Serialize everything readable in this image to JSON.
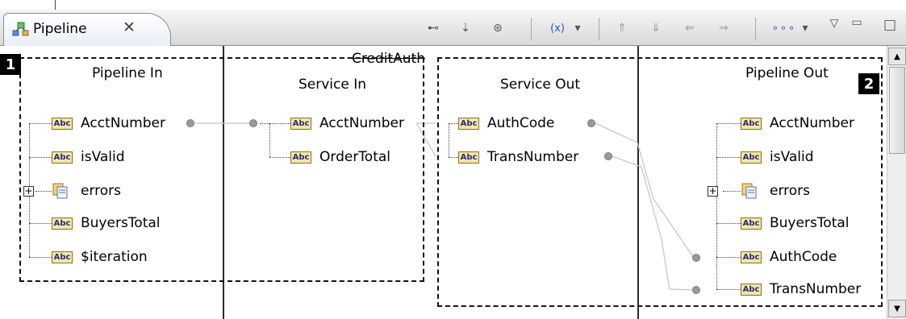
{
  "tab": {
    "title": "Pipeline",
    "close_glyph": "✕"
  },
  "toolbar": {
    "buttons": [
      {
        "icon": "link-icon",
        "glyph": "⊷"
      },
      {
        "icon": "map-value-icon",
        "glyph": "⇣"
      },
      {
        "icon": "drop-icon",
        "glyph": "⊛"
      },
      {
        "icon": "transformer-icon",
        "glyph": "(x)"
      },
      {
        "icon": "dropdown-arrow-icon",
        "glyph": "▾"
      },
      {
        "icon": "shift-up-icon",
        "glyph": "⇑"
      },
      {
        "icon": "shift-down-icon",
        "glyph": "⇓"
      },
      {
        "icon": "shift-left-icon",
        "glyph": "⇐"
      },
      {
        "icon": "shift-right-icon",
        "glyph": "⇒"
      },
      {
        "icon": "layout-icon",
        "glyph": "⚬⚬⚬"
      },
      {
        "icon": "dropdown-arrow-icon",
        "glyph": "▾"
      },
      {
        "icon": "view-menu-icon",
        "glyph": "▽"
      },
      {
        "icon": "minimize-icon",
        "glyph": "▭"
      },
      {
        "icon": "maximize-icon",
        "glyph": "□"
      }
    ]
  },
  "service_name": "CreditAuth",
  "columns": {
    "pipeline_in": "Pipeline In",
    "service_in": "Service In",
    "service_out": "Service Out",
    "pipeline_out": "Pipeline Out"
  },
  "markers": {
    "one": "1",
    "two": "2"
  },
  "type_badge": "Abc",
  "pipeline_in": [
    "AcctNumber",
    "isValid",
    "errors",
    "BuyersTotal",
    "$iteration"
  ],
  "service_in": [
    "AcctNumber",
    "OrderTotal"
  ],
  "service_out": [
    "AuthCode",
    "TransNumber"
  ],
  "pipeline_out": [
    "AcctNumber",
    "isValid",
    "errors",
    "BuyersTotal",
    "AuthCode",
    "TransNumber"
  ],
  "expander": "+",
  "scrollbar": {
    "up": "▲",
    "down": "▼"
  }
}
